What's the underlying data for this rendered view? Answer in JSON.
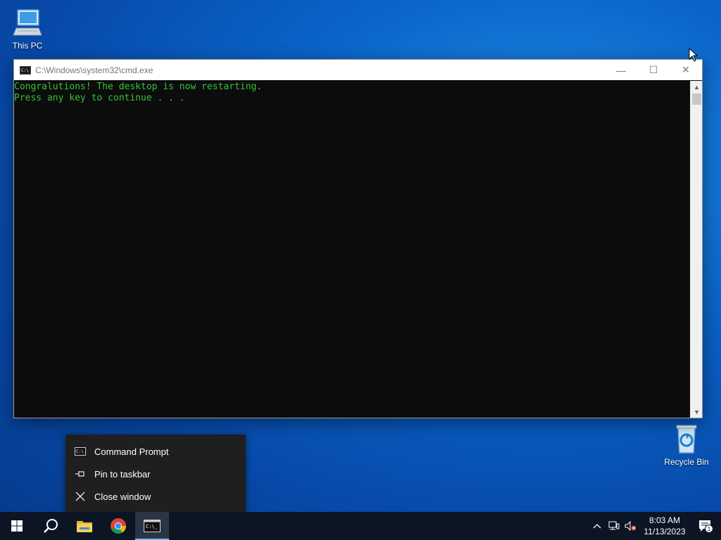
{
  "desktop": {
    "icons": [
      {
        "label": "This PC",
        "icon": "computer-icon"
      },
      {
        "label": "Recycle Bin",
        "icon": "recycle-bin-icon"
      }
    ]
  },
  "cmd_window": {
    "title": "C:\\Windows\\system32\\cmd.exe",
    "lines": [
      "Congralutions! The desktop is now restarting.",
      "Press any key to continue . . ."
    ],
    "controls": {
      "minimize": "—",
      "maximize": "☐",
      "close": "✕"
    },
    "text_color": "#35c235"
  },
  "jumplist": {
    "items": [
      {
        "label": "Command Prompt",
        "icon": "cmd-icon"
      },
      {
        "label": "Pin to taskbar",
        "icon": "pin-icon"
      },
      {
        "label": "Close window",
        "icon": "close-icon"
      }
    ]
  },
  "taskbar": {
    "apps": [
      {
        "name": "Start",
        "icon": "windows-icon"
      },
      {
        "name": "Search",
        "icon": "search-icon"
      },
      {
        "name": "File Explorer",
        "icon": "folder-icon"
      },
      {
        "name": "Google Chrome",
        "icon": "chrome-icon"
      },
      {
        "name": "Command Prompt",
        "icon": "cmd-icon",
        "active": true
      }
    ],
    "tray": {
      "time": "8:03 AM",
      "date": "11/13/2023",
      "notification_count": "1"
    }
  }
}
